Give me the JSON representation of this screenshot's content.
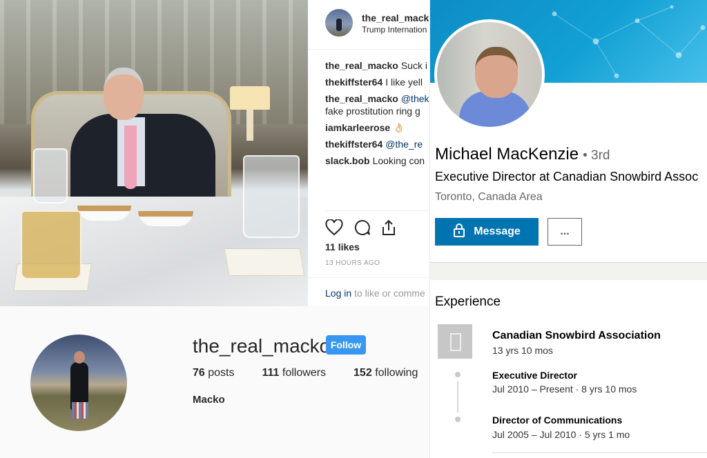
{
  "instagram_post": {
    "username": "the_real_mack",
    "location": "Trump Internation",
    "comments": [
      {
        "user": "the_real_macko",
        "text": "Suck i"
      },
      {
        "user": "thekiffster64",
        "text": "I like yell"
      },
      {
        "user": "the_real_macko",
        "mention": "@thek",
        "line2": "fake prostitution ring g"
      },
      {
        "user": "iamkarleerose",
        "text": "👌🏻"
      },
      {
        "user": "thekiffster64",
        "mention": "@the_re"
      },
      {
        "user": "slack.bob",
        "text": "Looking con"
      }
    ],
    "likes": "11 likes",
    "time_ago": "13 HOURS AGO",
    "login_link": "Log in",
    "login_rest": "to like or comme",
    "icons": [
      "heart-icon",
      "comment-icon",
      "share-icon"
    ]
  },
  "instagram_profile": {
    "username": "the_real_macko",
    "follow_label": "Follow",
    "posts_count": "76",
    "posts_label": "posts",
    "followers_count": "111",
    "followers_label": "followers",
    "following_count": "152",
    "following_label": "following",
    "full_name": "Macko"
  },
  "linkedin": {
    "name": "Michael MacKenzie",
    "degree": "• 3rd",
    "headline": "Executive Director at Canadian Snowbird Assoc",
    "location": "Toronto, Canada Area",
    "message_label": "Message",
    "more_label": "...",
    "experience_title": "Experience",
    "company": "Canadian Snowbird Association",
    "company_duration": "13 yrs 10 mos",
    "roles": [
      {
        "title": "Executive Director",
        "dates": "Jul 2010 – Present · 8 yrs 10 mos"
      },
      {
        "title": "Director of Communications",
        "dates": "Jul 2005 – Jul 2010 · 5 yrs 1 mo"
      }
    ],
    "colors": {
      "primary": "#0073b1",
      "banner": "#12a0d4"
    }
  },
  "colors": {
    "instagram_blue": "#3897f0",
    "instagram_link": "#003569"
  }
}
